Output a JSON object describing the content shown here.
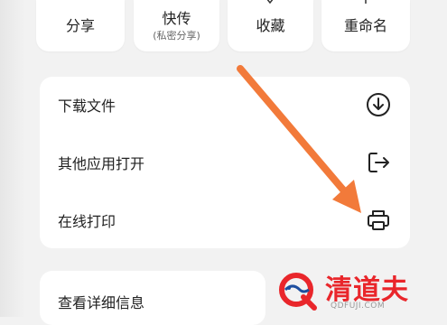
{
  "top_actions": [
    {
      "label": "分享"
    },
    {
      "label": "快传",
      "sub": "(私密分享)"
    },
    {
      "label": "收藏"
    },
    {
      "label": "重命名"
    }
  ],
  "menu": {
    "items": [
      {
        "label": "下载文件",
        "icon": "download-circle-icon"
      },
      {
        "label": "其他应用打开",
        "icon": "open-external-icon"
      },
      {
        "label": "在线打印",
        "icon": "printer-icon"
      }
    ]
  },
  "details": {
    "label": "查看详细信息"
  },
  "watermark": {
    "name": "清道夫",
    "url": "QDFUJI.COM"
  },
  "colors": {
    "arrow": "#f27a3a",
    "watermark_red": "#e9262b",
    "watermark_blue": "#1d4fa0"
  }
}
